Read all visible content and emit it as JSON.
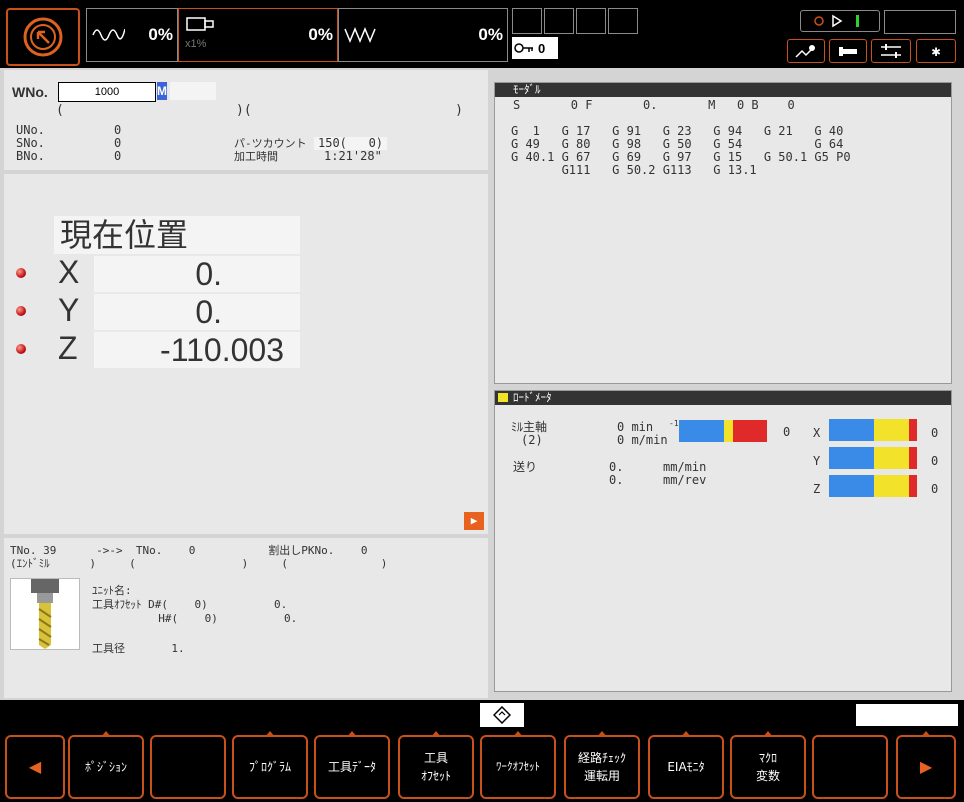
{
  "top": {
    "spindle_load": "0%",
    "feed_override": "0%",
    "override_sub": "x1%",
    "rapid_override": "0%",
    "counter_label": "0"
  },
  "work": {
    "wno_label": "WNo.",
    "wno_value": "1000",
    "m_tag": "M",
    "paren_line": "(                      )(                          )",
    "uno_label": "UNo.",
    "uno_value": "0",
    "sno_label": "SNo.",
    "sno_value": "0",
    "bno_label": "BNo.",
    "bno_value": "0",
    "parts_label": "パ-ツカウント",
    "parts_value": "150(   0)",
    "time_label": "加工時間",
    "time_value": "1:21'28\""
  },
  "position": {
    "title": "現在位置",
    "axes": [
      {
        "name": "X",
        "value": "0."
      },
      {
        "name": "Y",
        "value": "0."
      },
      {
        "name": "Z",
        "value": "-110.003"
      }
    ]
  },
  "tool": {
    "line1": "TNo. 39      ->->  TNo.    0           割出しPKNo.    0",
    "line2": "(ｴﾝﾄﾞﾐﾙ      )     (                )     (              )",
    "unit_label": "ﾕﾆｯﾄ名:",
    "offset_d": "工具ｵﾌｾｯﾄ D#(    0)          0.",
    "offset_h": "          H#(    0)          0.",
    "dia": "工具径       1."
  },
  "modal": {
    "title": "ﾓｰﾀﾞﾙ",
    "top_line": "S       0 F       0.       M   0 B    0",
    "lines": [
      "G  1   G 17   G 91   G 23   G 94   G 21   G 40",
      "G 49   G 80   G 98   G 50   G 54          G 64",
      "G 40.1 G 67   G 69   G 97   G 15   G 50.1 G5 P0",
      "       G111   G 50.2 G113   G 13.1"
    ]
  },
  "load": {
    "title": "ﾛｰﾄﾞﾒｰﾀ",
    "spindle_label": "ﾐﾙ主軸",
    "spindle_sub": "(2)",
    "spindle_v1": "0 min",
    "spindle_sup": "-1",
    "spindle_v2": "0 m/min",
    "spindle_load": "0",
    "feed_label": "送り",
    "feed_v1": "0.",
    "feed_v2": "0.",
    "feed_u1": "mm/min",
    "feed_u2": "mm/rev",
    "axes": [
      {
        "name": "X",
        "value": "0"
      },
      {
        "name": "Y",
        "value": "0"
      },
      {
        "name": "Z",
        "value": "0"
      }
    ]
  },
  "softkeys": [
    {
      "l1": "ﾎﾟｼﾞｼｮﾝ",
      "l2": ""
    },
    {
      "l1": "",
      "l2": ""
    },
    {
      "l1": "ﾌﾟﾛｸﾞﾗﾑ",
      "l2": ""
    },
    {
      "l1": "工具ﾃﾞｰﾀ",
      "l2": ""
    },
    {
      "l1": "工具",
      "l2": "ｵﾌｾｯﾄ"
    },
    {
      "l1": "ﾜｰｸｵﾌｾｯﾄ",
      "l2": ""
    },
    {
      "l1": "経路ﾁｪｯｸ",
      "l2": "運転用"
    },
    {
      "l1": "EIAﾓﾆﾀ",
      "l2": ""
    },
    {
      "l1": "ﾏｸﾛ",
      "l2": "変数"
    },
    {
      "l1": "",
      "l2": ""
    }
  ],
  "colors": {
    "accent": "#c8501a",
    "panel": "#e8e8e8",
    "bar_blue": "#3a8be8",
    "bar_yellow": "#f2e22a",
    "bar_red": "#e02a2a"
  }
}
